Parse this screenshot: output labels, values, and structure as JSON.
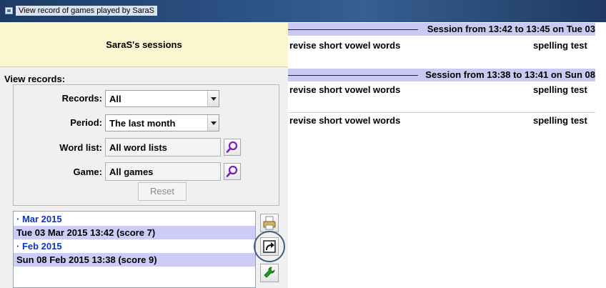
{
  "window": {
    "title": "View record of games played by SaraS"
  },
  "left_panel": {
    "banner": "SaraS's sessions",
    "view_records_label": "View records:",
    "filters": {
      "records_label": "Records:",
      "records_value": "All",
      "period_label": "Period:",
      "period_value": "The last month",
      "wordlist_label": "Word list:",
      "wordlist_value": "All word lists",
      "game_label": "Game:",
      "game_value": "All games",
      "reset_label": "Reset"
    },
    "session_list": [
      {
        "type": "month",
        "text": "· Mar 2015"
      },
      {
        "type": "session",
        "text": "Tue 03 Mar 2015  13:42 (score  7)"
      },
      {
        "type": "month",
        "text": "· Feb 2015"
      },
      {
        "type": "session",
        "text": "Sun 08 Feb 2015  13:38 (score  9)"
      }
    ]
  },
  "right_panel": {
    "sessions": [
      {
        "header": "Session from 13:42 to 13:45 on Tue 03",
        "rows": [
          {
            "game": "revise short vowel words",
            "type": "spelling test"
          }
        ]
      },
      {
        "header": "Session from 13:38 to 13:41 on Sun 08",
        "rows": [
          {
            "game": "revise short vowel words",
            "type": "spelling test"
          },
          {
            "game": "revise short vowel words",
            "type": "spelling test"
          }
        ]
      }
    ]
  },
  "icons": {
    "window": "window-icon",
    "search": "magnifier-icon",
    "print": "printer-icon",
    "export": "export-arrow-icon",
    "tools": "wrench-icon"
  },
  "colors": {
    "banner": "#fbf6cf",
    "header_bar": "#c9c9f4",
    "session_row": "#ccccf6",
    "month_text": "#1133bb",
    "search_icon": "#7a1fb0",
    "wrench": "#1d9a1d"
  }
}
